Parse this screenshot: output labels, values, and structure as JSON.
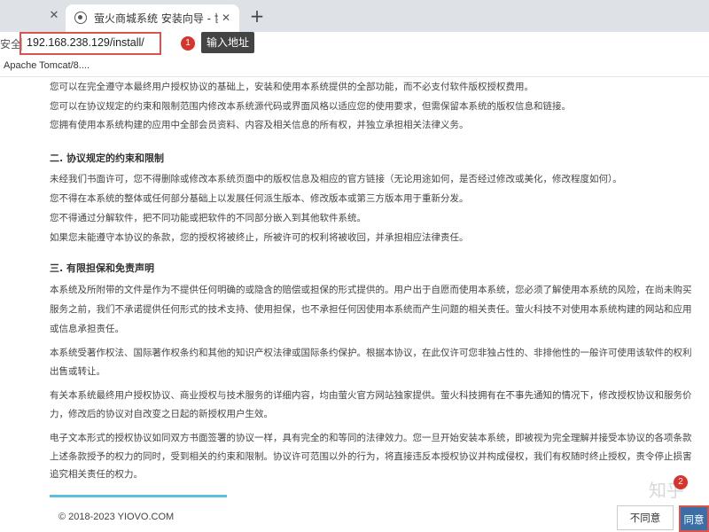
{
  "browser": {
    "tab_close_left": "✕",
    "tab_title": "萤火商城系统 安装向导 - 协议说",
    "tab_close": "✕",
    "new_tab": "+",
    "security_label": "安全",
    "url": "192.168.238.129/install/",
    "bookmark": "Apache Tomcat/8...."
  },
  "annotations": {
    "step1_number": "1",
    "step1_label": "输入地址",
    "step2_number": "2",
    "highlight_color": "#d9534f"
  },
  "agreement": {
    "paragraphs": [
      "您可以在完全遵守本最终用户授权协议的基础上，安装和使用本系统提供的全部功能，而不必支付软件版权授权费用。",
      "您可以在协议规定的约束和限制范围内修改本系统源代码或界面风格以适应您的使用要求，但需保留本系统的版权信息和链接。",
      "您拥有使用本系统构建的应用中全部会员资料、内容及相关信息的所有权，并独立承担相关法律义务。"
    ],
    "section2_heading": "二. 协议规定的约束和限制",
    "section2": [
      "未经我们书面许可，您不得删除或修改本系统页面中的版权信息及相应的官方链接（无论用途如何，是否经过修改或美化，修改程度如何）。",
      "您不得在本系统的整体或任何部分基础上以发展任何派生版本、修改版本或第三方版本用于重新分发。",
      "您不得通过分解软件，把不同功能或把软件的不同部分嵌入到其他软件系统。",
      "如果您未能遵守本协议的条款，您的授权将被终止，所被许可的权利将被收回，并承担相应法律责任。"
    ],
    "section3_heading": "三. 有限担保和免责声明",
    "section3": [
      "本系统及所附带的文件是作为不提供任何明确的或隐含的赔偿或担保的形式提供的。用户出于自愿而使用本系统，您必须了解使用本系统的风险，在尚未购买",
      "服务之前，我们不承诺提供任何形式的技术支持、使用担保，也不承担任何因使用本系统而产生问题的相关责任。萤火科技不对使用本系统构建的网站和应用",
      "或信息承担责任。",
      "本系统受著作权法、国际著作权条约和其他的知识产权法律或国际条约保护。根据本协议，在此仅许可您非独占性的、非排他性的一般许可使用该软件的权利",
      "出售或转让。",
      "有关本系统最终用户授权协议、商业授权与技术服务的详细内容，均由萤火官方网站独家提供。萤火科技拥有在不事先通知的情况下，修改授权协议和服务价",
      "力，修改后的协议对自改变之日起的新授权用户生效。",
      "电子文本形式的授权协议如同双方书面签署的协议一样，具有完全的和等同的法律效力。您一旦开始安装本系统，即被视为完全理解并接受本协议的各项条款",
      "上述条款授予的权力的同时，受到相关的约束和限制。协议许可范围以外的行为，将直接违反本授权协议并构成侵权，我们有权随时终止授权，责令停止损害",
      "追究相关责任的权力。"
    ]
  },
  "footer": {
    "copyright": "© 2018-2023 YIOVO.COM",
    "disagree_label": "不同意",
    "agree_label": "同意",
    "watermark": "知乎"
  }
}
